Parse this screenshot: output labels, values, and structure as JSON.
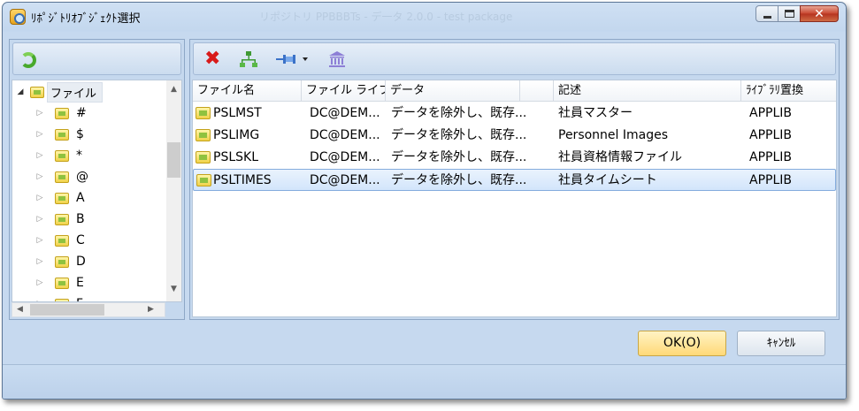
{
  "window": {
    "title": "ﾘﾎﾟｼﾞﾄﾘｵﾌﾞｼﾞｪｸﾄ選択",
    "watermark": "リポジトリ PPBBBTs - デ一タ 2.0.0 - test package"
  },
  "tree": {
    "root_label": "ファイル",
    "items": [
      "#",
      "$",
      "*",
      "@",
      "A",
      "B",
      "C",
      "D",
      "E",
      "F"
    ]
  },
  "grid": {
    "columns": [
      "ファイル名",
      "ファイル ライブ...",
      "データ",
      "",
      "記述",
      "ﾗｲﾌﾞﾗﾘ置換"
    ],
    "rows": [
      {
        "name": "PSLMST",
        "library": "DC@DEM...",
        "data": "データを除外し、既存...",
        "description": "社員マスター",
        "library_replace": "APPLIB"
      },
      {
        "name": "PSLIMG",
        "library": "DC@DEM...",
        "data": "データを除外し、既存...",
        "description": "Personnel Images",
        "library_replace": "APPLIB"
      },
      {
        "name": "PSLSKL",
        "library": "DC@DEM...",
        "data": "データを除外し、既存...",
        "description": "社員資格情報ファイル",
        "library_replace": "APPLIB"
      },
      {
        "name": "PSLTIMES",
        "library": "DC@DEM...",
        "data": "データを除外し、既存...",
        "description": "社員タイムシート",
        "library_replace": "APPLIB"
      }
    ],
    "selected_row": "PSLTIMES"
  },
  "buttons": {
    "ok": "OK(O)",
    "cancel": "ｷｬﾝｾﾙ"
  },
  "icons": {
    "refresh": "refresh-icon",
    "delete": "delete-icon",
    "hierarchy": "hierarchy-icon",
    "pin": "pin-icon",
    "dropdown": "chevron-down-icon",
    "bank": "bank-icon",
    "folder": "folder-icon"
  },
  "colors": {
    "window_bg": "#c6d9ef",
    "ok_button": "#ffd978",
    "selection": "#d2e5fb",
    "delete": "#d81a1a"
  }
}
